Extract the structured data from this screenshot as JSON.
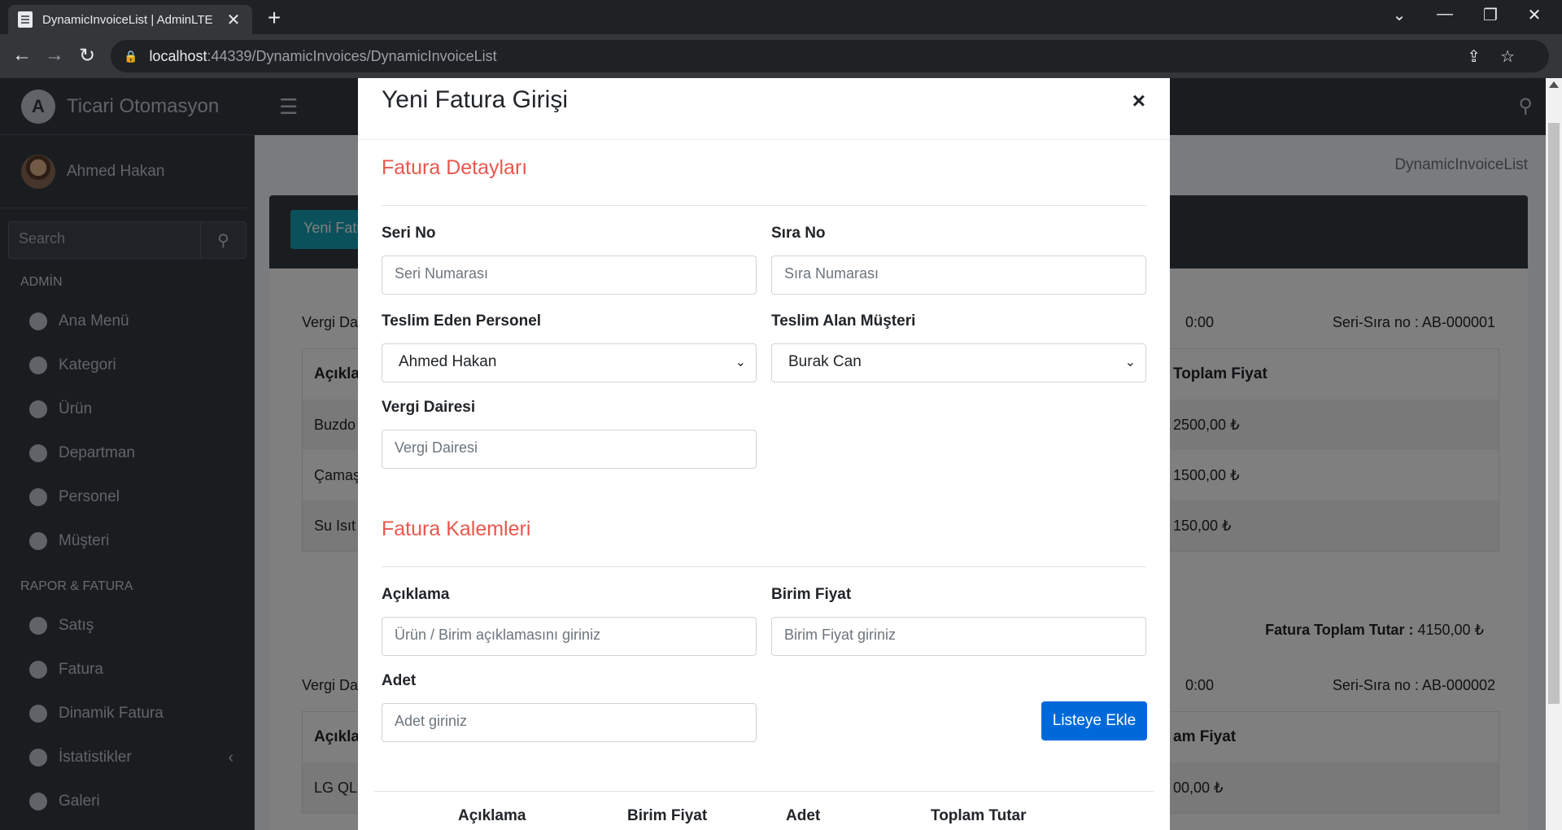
{
  "browser": {
    "tab_title": "DynamicInvoiceList | AdminLTE",
    "tab_close": "✕",
    "new_tab": "+",
    "url_host": "localhost",
    "url_rest": ":44339/DynamicInvoices/DynamicInvoiceList"
  },
  "sidebar": {
    "brand": "Ticari Otomasyon",
    "brand_logo": "A",
    "user": "Ahmed Hakan",
    "search_placeholder": "Search",
    "header_admin": "ADMİN",
    "admin_items": [
      "Ana Menü",
      "Kategori",
      "Ürün",
      "Departman",
      "Personel",
      "Müşteri"
    ],
    "header_report": "RAPOR & FATURA",
    "report_items": [
      "Satış",
      "Fatura",
      "Dinamik Fatura",
      "İstatistikler",
      "Galeri"
    ]
  },
  "page": {
    "breadcrumb": "DynamicInvoiceList",
    "new_button": "Yeni Fatura",
    "invoice1": {
      "vergi_label": "Vergi Da",
      "time": "0:00",
      "seri": "Seri-Sıra no : AB-000001",
      "col_first": "Açıkla",
      "col_last": "Toplam Fiyat",
      "rows": [
        {
          "desc": "Buzdo",
          "price": "2500,00 ₺"
        },
        {
          "desc": "Çamaş",
          "price": "1500,00 ₺"
        },
        {
          "desc": "Su Isıt",
          "price": "150,00 ₺"
        }
      ],
      "total_label": "Fatura Toplam Tutar :",
      "total_value": "4150,00 ₺"
    },
    "invoice2": {
      "vergi_label": "Vergi Da",
      "time": "0:00",
      "seri": "Seri-Sıra no : AB-000002",
      "col_first": "Açıkla",
      "col_last": "am Fiyat",
      "row1_desc": "LG QLI",
      "row1_price": "00,00 ₺"
    }
  },
  "modal": {
    "title": "Yeni Fatura Girişi",
    "close": "×",
    "section1": "Fatura Detayları",
    "seri_label": "Seri No",
    "seri_placeholder": "Seri Numarası",
    "sira_label": "Sıra No",
    "sira_placeholder": "Sıra Numarası",
    "personel_label": "Teslim Eden Personel",
    "personel_value": "Ahmed Hakan",
    "musteri_label": "Teslim Alan Müşteri",
    "musteri_value": "Burak Can",
    "vergi_label": "Vergi Dairesi",
    "vergi_placeholder": "Vergi Dairesi",
    "section2": "Fatura Kalemleri",
    "aciklama_label": "Açıklama",
    "aciklama_placeholder": "Ürün / Birim açıklamasını giriniz",
    "birim_label": "Birim Fiyat",
    "birim_placeholder": "Birim Fiyat giriniz",
    "adet_label": "Adet",
    "adet_placeholder": "Adet giriniz",
    "add_button": "Listeye Ekle",
    "list_headers": [
      "Açıklama",
      "Birim Fiyat",
      "Adet",
      "Toplam Tutar"
    ]
  }
}
